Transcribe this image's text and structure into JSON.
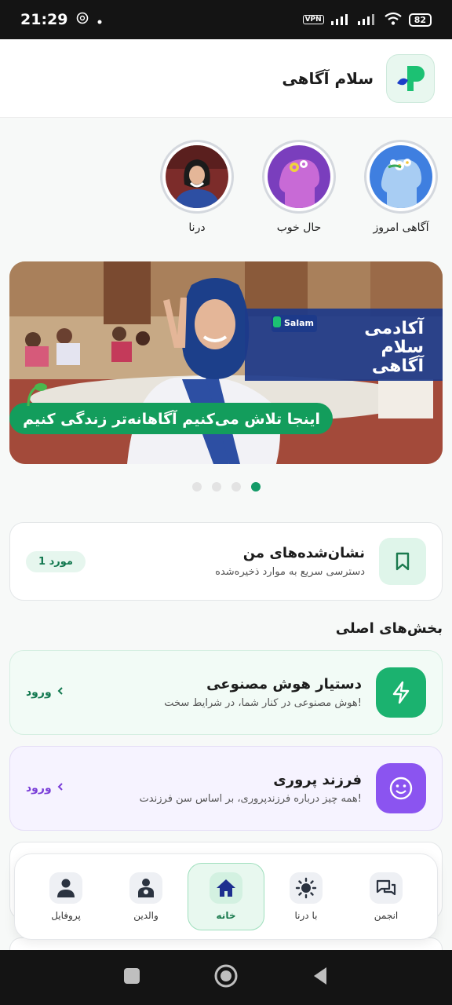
{
  "status": {
    "time": "21:29",
    "vpn": "VPN",
    "battery": "82"
  },
  "header": {
    "title": "سلام آگاهی"
  },
  "stories": [
    {
      "label": "آگاهی امروز"
    },
    {
      "label": "حال خوب"
    },
    {
      "label": "درنا"
    }
  ],
  "banner": {
    "brand": "Salam",
    "title_lines": [
      "آکادمی",
      "سلام",
      "آگاهی"
    ],
    "slogan": "اینجا تلاش می‌کنیم آگاهانه‌تر زندگی کنیم",
    "slide_count": 4,
    "active_slide": 4
  },
  "saved": {
    "title": "نشان‌شده‌های من",
    "subtitle": "دسترسی سریع به موارد ذخیره‌شده",
    "count": "1 مورد"
  },
  "main_sections": {
    "title": "بخش‌های اصلی",
    "items": [
      {
        "title": "دستیار هوش مصنوعی",
        "subtitle": "هوش مصنوعی در کنار شما، در شرایط سخت!",
        "action": "ورود",
        "color": "#1bb26f"
      },
      {
        "title": "فرزند پروری",
        "subtitle": "همه چیز درباره فرزندپروری، بر اساس سن فرزندت!",
        "action": "ورود",
        "color": "#8b54f0"
      }
    ]
  },
  "bottom_nav": [
    {
      "label": "انجمن",
      "icon": "forum-icon"
    },
    {
      "label": "با درنا",
      "icon": "sun-icon"
    },
    {
      "label": "خانه",
      "icon": "home-icon",
      "active": true
    },
    {
      "label": "والدین",
      "icon": "parents-icon"
    },
    {
      "label": "پروفایل",
      "icon": "profile-icon"
    }
  ],
  "colors": {
    "accent": "#129a67",
    "purple": "#8b54f0"
  }
}
